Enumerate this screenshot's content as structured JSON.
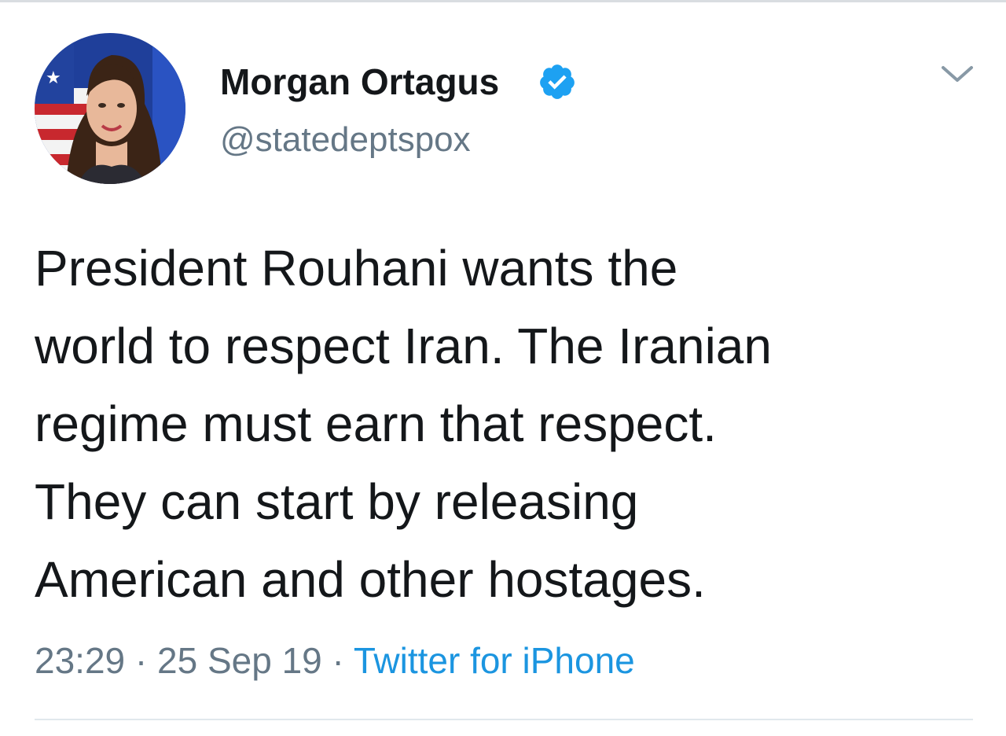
{
  "author": {
    "display_name": "Morgan Ortagus",
    "handle": "@statedeptspox",
    "verified": true
  },
  "tweet": {
    "lines": [
      "President Rouhani wants the",
      "world to respect Iran. The Iranian",
      "regime must earn that respect.",
      "They can start by releasing",
      "American and other hostages."
    ],
    "time": "23:29",
    "separator": "·",
    "date": "25 Sep 19",
    "source": "Twitter for iPhone"
  },
  "icons": {
    "verified": "verified-badge-icon",
    "menu": "chevron-down-icon"
  },
  "colors": {
    "text": "#14171a",
    "secondary": "#657786",
    "link": "#1b95e0",
    "verified": "#1da1f2",
    "divider": "#e1e8ed"
  }
}
